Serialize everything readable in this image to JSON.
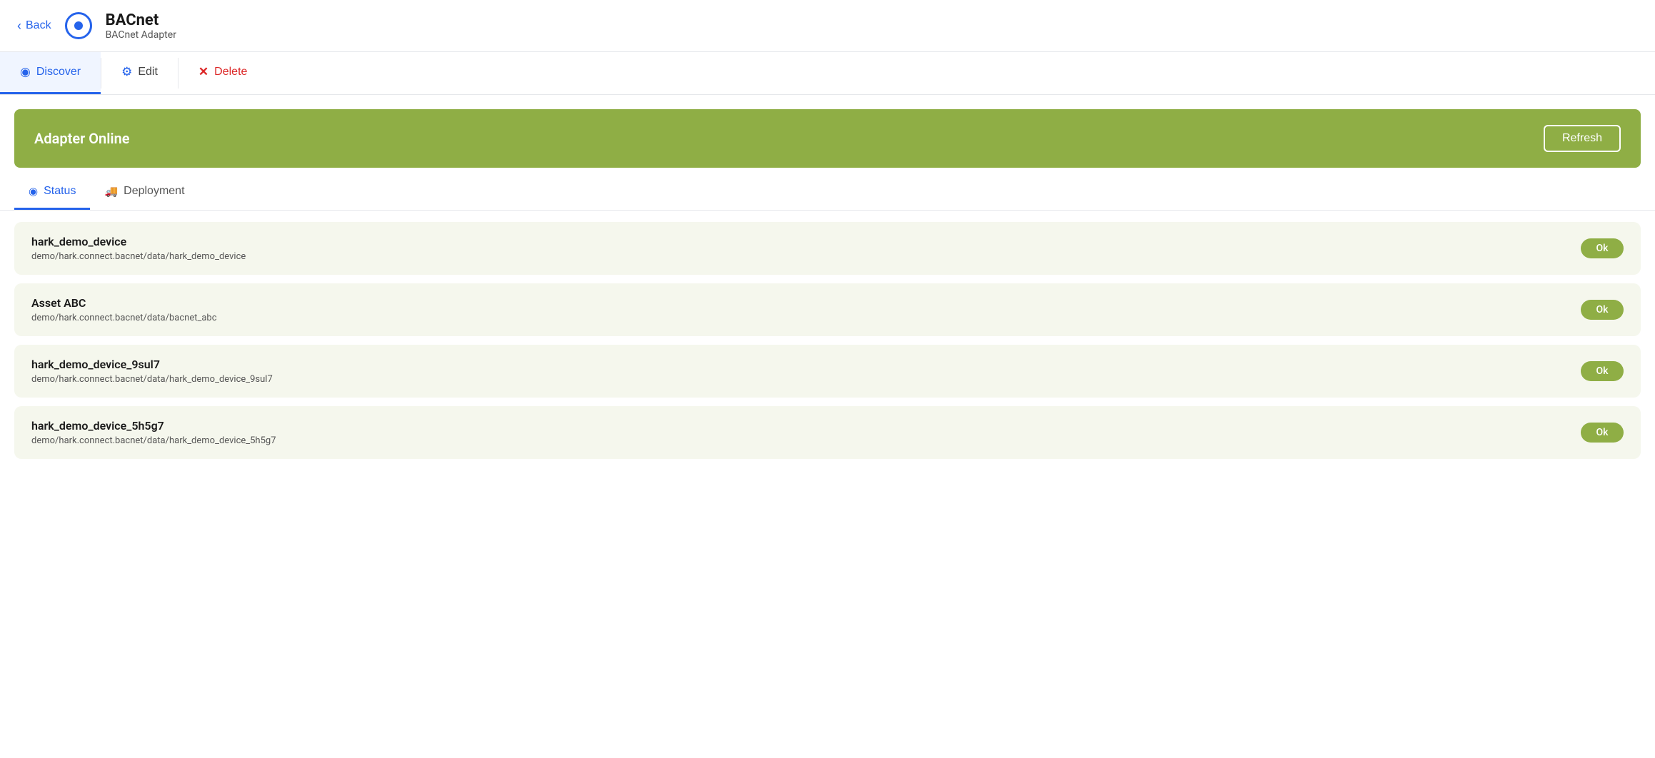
{
  "header": {
    "back_label": "Back",
    "title": "BACnet",
    "subtitle": "BACnet Adapter"
  },
  "tabs": [
    {
      "id": "discover",
      "label": "Discover",
      "icon": "radio-icon",
      "active": true
    },
    {
      "id": "edit",
      "label": "Edit",
      "icon": "gear-icon",
      "active": false
    },
    {
      "id": "delete",
      "label": "Delete",
      "icon": "x-icon",
      "active": false
    }
  ],
  "banner": {
    "text": "Adapter Online",
    "refresh_label": "Refresh"
  },
  "sub_tabs": [
    {
      "id": "status",
      "label": "Status",
      "icon": "radio-icon",
      "active": true
    },
    {
      "id": "deployment",
      "label": "Deployment",
      "icon": "truck-icon",
      "active": false
    }
  ],
  "devices": [
    {
      "name": "hark_demo_device",
      "path": "demo/hark.connect.bacnet/data/hark_demo_device",
      "status": "Ok"
    },
    {
      "name": "Asset ABC",
      "path": "demo/hark.connect.bacnet/data/bacnet_abc",
      "status": "Ok"
    },
    {
      "name": "hark_demo_device_9sul7",
      "path": "demo/hark.connect.bacnet/data/hark_demo_device_9sul7",
      "status": "Ok"
    },
    {
      "name": "hark_demo_device_5h5g7",
      "path": "demo/hark.connect.bacnet/data/hark_demo_device_5h5g7",
      "status": "Ok"
    }
  ],
  "colors": {
    "accent_blue": "#2563eb",
    "accent_green": "#8fae45",
    "delete_red": "#dc2626"
  }
}
